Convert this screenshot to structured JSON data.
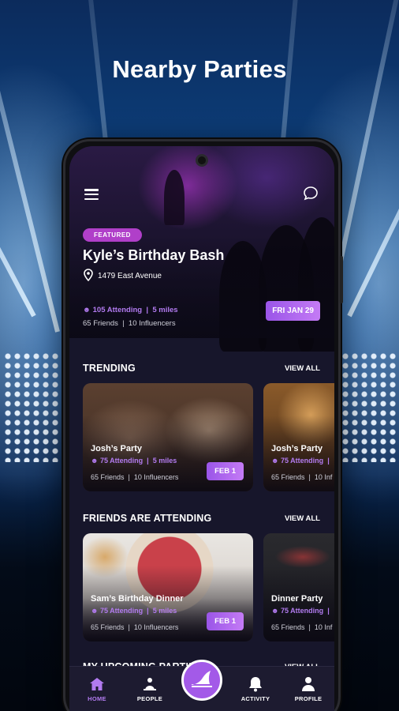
{
  "headline": "Nearby Parties",
  "featured": {
    "badge": "FEATURED",
    "title": "Kyle’s Birthday Bash",
    "location": "1479 East Avenue",
    "attending": "105 Attending",
    "distance": "5 miles",
    "friends": "65 Friends",
    "influencers": "10 Influencers",
    "date": "FRI JAN 29"
  },
  "trending": {
    "title": "TRENDING",
    "view_all": "VIEW ALL",
    "cards": [
      {
        "title": "Josh’s Party",
        "attending": "75 Attending",
        "distance": "5 miles",
        "friends": "65 Friends",
        "influencers": "10 Influencers",
        "date": "FEB 1"
      },
      {
        "title": "Josh’s Party",
        "attending": "75 Attending",
        "distance": "|",
        "friends": "65 Friends",
        "influencers": "10 Inf"
      }
    ]
  },
  "friends_attending": {
    "title": "FRIENDS ARE ATTENDING",
    "view_all": "VIEW ALL",
    "cards": [
      {
        "title": "Sam’s Birthday Dinner",
        "attending": "75 Attending",
        "distance": "5 miles",
        "friends": "65 Friends",
        "influencers": "10 Influencers",
        "date": "FEB 1"
      },
      {
        "title": "Dinner Party",
        "attending": "75 Attending",
        "distance": "|",
        "friends": "65 Friends",
        "influencers": "10 Inf"
      }
    ]
  },
  "upcoming": {
    "title": "MY UPCOMING PARTIES",
    "view_all": "VIEW ALL"
  },
  "nav": {
    "home": "HOME",
    "people": "PEOPLE",
    "activity": "ACTIVITY",
    "profile": "PROFILE",
    "active": "home",
    "center_icon": "shark-fin-icon"
  },
  "colors": {
    "accent": "#b27bf0",
    "badge": "#b03fc9",
    "screen_bg": "#17162b",
    "nav_bg": "#1d1b30"
  }
}
